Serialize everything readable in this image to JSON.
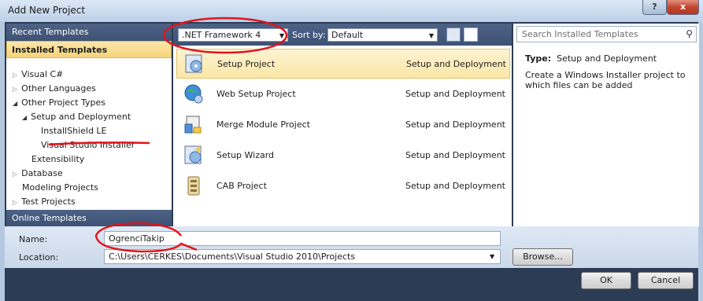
{
  "window": {
    "title": "Add New Project",
    "help": "?",
    "close": "x"
  },
  "left": {
    "recent": "Recent Templates",
    "installed": "Installed Templates",
    "online": "Online Templates",
    "tree": [
      {
        "label": "Visual C#"
      },
      {
        "label": "Other Languages"
      },
      {
        "label": "Other Project Types"
      },
      {
        "label": "Setup and Deployment"
      },
      {
        "label": "InstallShield LE"
      },
      {
        "label": "Visual Studio Installer"
      },
      {
        "label": "Extensibility"
      },
      {
        "label": "Database"
      },
      {
        "label": "Modeling Projects"
      },
      {
        "label": "Test Projects"
      }
    ]
  },
  "toolbar": {
    "framework": ".NET Framework 4",
    "sort_label": "Sort by:",
    "sort_value": "Default"
  },
  "templates": [
    {
      "name": "Setup Project",
      "category": "Setup and Deployment",
      "icon": "setup-project-icon"
    },
    {
      "name": "Web Setup Project",
      "category": "Setup and Deployment",
      "icon": "web-setup-icon"
    },
    {
      "name": "Merge Module Project",
      "category": "Setup and Deployment",
      "icon": "merge-module-icon"
    },
    {
      "name": "Setup Wizard",
      "category": "Setup and Deployment",
      "icon": "setup-wizard-icon"
    },
    {
      "name": "CAB Project",
      "category": "Setup and Deployment",
      "icon": "cab-project-icon"
    }
  ],
  "search": {
    "placeholder": "Search Installed Templates"
  },
  "info": {
    "type_label": "Type:",
    "type_value": "Setup and Deployment",
    "description": "Create a Windows Installer project to which files can be added"
  },
  "form": {
    "name_label": "Name:",
    "name_value": "OgrenciTakip",
    "location_label": "Location:",
    "location_value": "C:\\Users\\CERKES\\Documents\\Visual Studio 2010\\Projects",
    "browse": "Browse..."
  },
  "footer": {
    "ok": "OK",
    "cancel": "Cancel"
  },
  "colors": {
    "annotation": "#e0141b",
    "selection": "#fbe6a6",
    "panel_header": "#3d5275"
  }
}
